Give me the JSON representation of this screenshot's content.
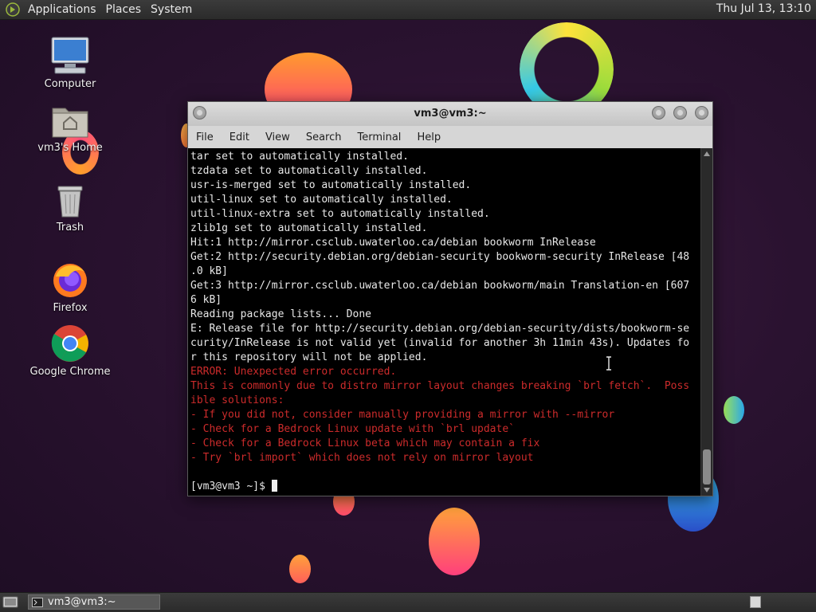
{
  "top_panel": {
    "menus": [
      "Applications",
      "Places",
      "System"
    ],
    "clock": "Thu Jul 13, 13:10"
  },
  "desktop_icons": [
    {
      "label": "Computer",
      "icon": "computer-icon"
    },
    {
      "label": "vm3's Home",
      "icon": "home-folder-icon"
    },
    {
      "label": "Trash",
      "icon": "trash-icon"
    },
    {
      "label": "Firefox",
      "icon": "firefox-icon"
    },
    {
      "label": "Google Chrome",
      "icon": "chrome-icon"
    }
  ],
  "window": {
    "title": "vm3@vm3:~",
    "menu": [
      "File",
      "Edit",
      "View",
      "Search",
      "Terminal",
      "Help"
    ]
  },
  "terminal": {
    "lines": [
      {
        "text": "tar set to automatically installed.",
        "type": "out"
      },
      {
        "text": "tzdata set to automatically installed.",
        "type": "out"
      },
      {
        "text": "usr-is-merged set to automatically installed.",
        "type": "out"
      },
      {
        "text": "util-linux set to automatically installed.",
        "type": "out"
      },
      {
        "text": "util-linux-extra set to automatically installed.",
        "type": "out"
      },
      {
        "text": "zlib1g set to automatically installed.",
        "type": "out"
      },
      {
        "text": "Hit:1 http://mirror.csclub.uwaterloo.ca/debian bookworm InRelease",
        "type": "out"
      },
      {
        "text": "Get:2 http://security.debian.org/debian-security bookworm-security InRelease [48",
        "type": "out"
      },
      {
        "text": ".0 kB]",
        "type": "out"
      },
      {
        "text": "Get:3 http://mirror.csclub.uwaterloo.ca/debian bookworm/main Translation-en [607",
        "type": "out"
      },
      {
        "text": "6 kB]",
        "type": "out"
      },
      {
        "text": "Reading package lists... Done",
        "type": "out"
      },
      {
        "text": "E: Release file for http://security.debian.org/debian-security/dists/bookworm-se",
        "type": "out"
      },
      {
        "text": "curity/InRelease is not valid yet (invalid for another 3h 11min 43s). Updates fo",
        "type": "out"
      },
      {
        "text": "r this repository will not be applied.",
        "type": "out"
      },
      {
        "text": "ERROR: Unexpected error occurred.",
        "type": "err"
      },
      {
        "text": "This is commonly due to distro mirror layout changes breaking `brl fetch`.  Poss",
        "type": "err"
      },
      {
        "text": "ible solutions:",
        "type": "err"
      },
      {
        "text": "- If you did not, consider manually providing a mirror with --mirror",
        "type": "err"
      },
      {
        "text": "- Check for a Bedrock Linux update with `brl update`",
        "type": "err"
      },
      {
        "text": "- Check for a Bedrock Linux beta which may contain a fix",
        "type": "err"
      },
      {
        "text": "- Try `brl import` which does not rely on mirror layout",
        "type": "err"
      },
      {
        "text": "",
        "type": "out"
      }
    ],
    "prompt": "[vm3@vm3 ~]$ "
  },
  "taskbar": {
    "task_label": "vm3@vm3:~"
  },
  "colors": {
    "error_text": "#cc2b2b",
    "terminal_bg": "#000000",
    "terminal_fg": "#e8e8e8"
  }
}
